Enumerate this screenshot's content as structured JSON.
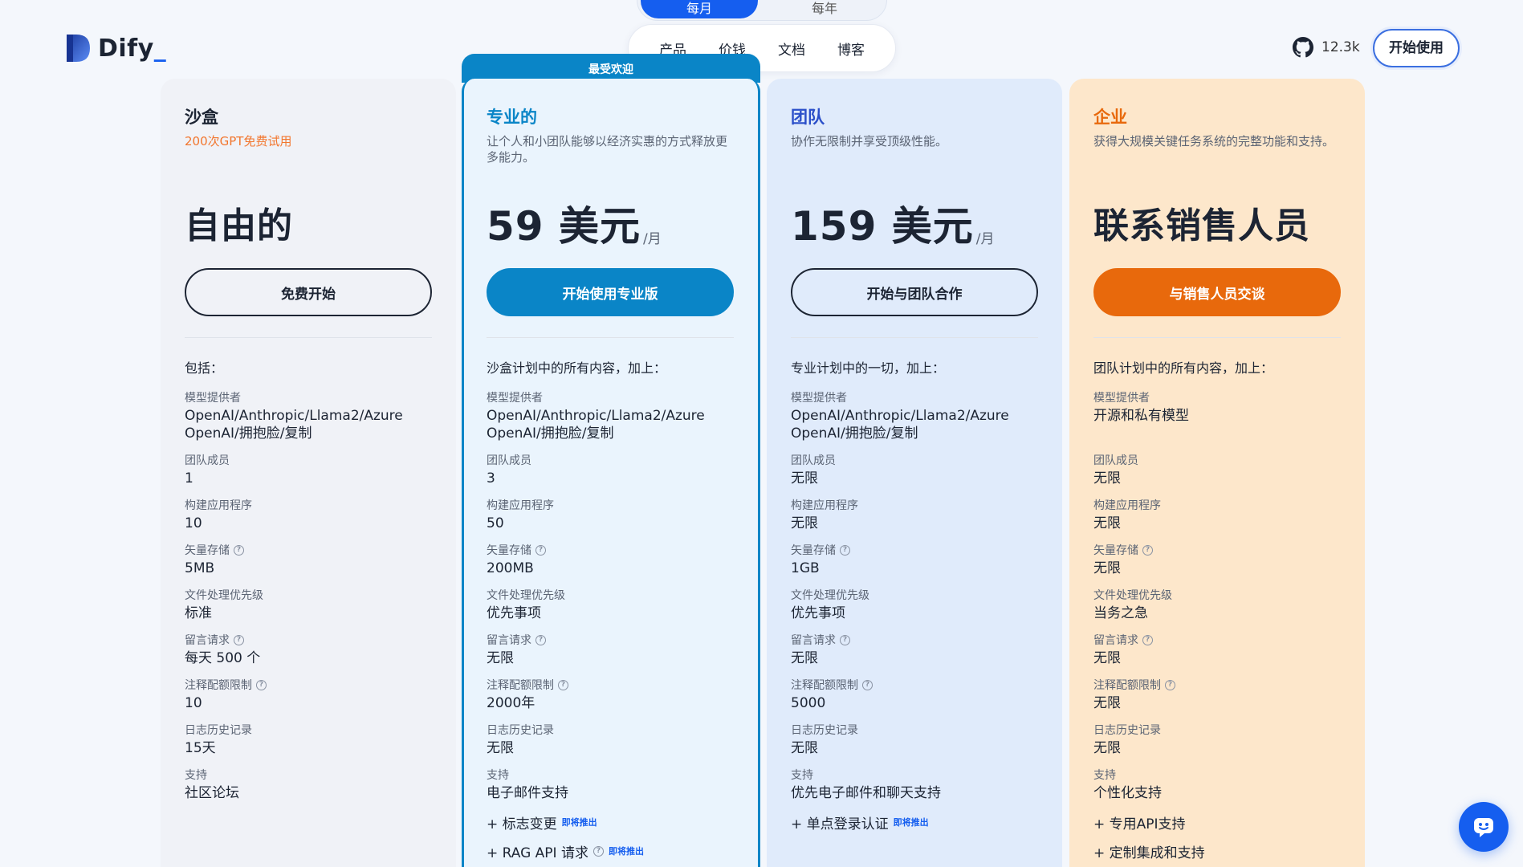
{
  "logo": {
    "name": "Dify",
    "suffix": "_"
  },
  "period_toggle": {
    "active": "每月",
    "inactive": "每年"
  },
  "nav": {
    "items": [
      "产品",
      "价钱",
      "文档",
      "博客"
    ]
  },
  "github": {
    "stars": "12.3k"
  },
  "header": {
    "start_label": "开始使用"
  },
  "ribbon": "最受欢迎",
  "plans": [
    {
      "name": "沙盒",
      "desc": "200次GPT免费试用",
      "price": "自由的",
      "per": "",
      "cta": "免费开始",
      "includes": "包括：",
      "features": [
        {
          "label": "模型提供者",
          "value": "OpenAI/Anthropic/Llama2/Azure OpenAI/拥抱脸/复制"
        },
        {
          "label": "团队成员",
          "value": "1"
        },
        {
          "label": "构建应用程序",
          "value": "10"
        },
        {
          "label": "矢量存储",
          "value": "5MB"
        },
        {
          "label": "文件处理优先级",
          "value": "标准"
        },
        {
          "label": "留言请求",
          "value": "每天 500 个"
        },
        {
          "label": "注释配额限制",
          "value": "10"
        },
        {
          "label": "日志历史记录",
          "value": "15天"
        },
        {
          "label": "支持",
          "value": "社区论坛"
        }
      ],
      "extras": []
    },
    {
      "name": "专业的",
      "desc": "让个人和小团队能够以经济实惠的方式释放更多能力。",
      "price": "59 美元",
      "per": "/月",
      "cta": "开始使用专业版",
      "includes": "沙盒计划中的所有内容，加上：",
      "features": [
        {
          "label": "模型提供者",
          "value": "OpenAI/Anthropic/Llama2/Azure OpenAI/拥抱脸/复制"
        },
        {
          "label": "团队成员",
          "value": "3"
        },
        {
          "label": "构建应用程序",
          "value": "50"
        },
        {
          "label": "矢量存储",
          "value": "200MB"
        },
        {
          "label": "文件处理优先级",
          "value": "优先事项"
        },
        {
          "label": "留言请求",
          "value": "无限"
        },
        {
          "label": "注释配额限制",
          "value": "2000年"
        },
        {
          "label": "日志历史记录",
          "value": "无限"
        },
        {
          "label": "支持",
          "value": "电子邮件支持"
        }
      ],
      "extras": [
        {
          "text": "+ 标志变更",
          "soon": "即将推出"
        },
        {
          "text": "+ RAG API 请求",
          "soon": "即将推出"
        }
      ]
    },
    {
      "name": "团队",
      "desc": "协作无限制并享受顶级性能。",
      "price": "159 美元",
      "per": "/月",
      "cta": "开始与团队合作",
      "includes": "专业计划中的一切，加上：",
      "features": [
        {
          "label": "模型提供者",
          "value": "OpenAI/Anthropic/Llama2/Azure OpenAI/拥抱脸/复制"
        },
        {
          "label": "团队成员",
          "value": "无限"
        },
        {
          "label": "构建应用程序",
          "value": "无限"
        },
        {
          "label": "矢量存储",
          "value": "1GB"
        },
        {
          "label": "文件处理优先级",
          "value": "优先事项"
        },
        {
          "label": "留言请求",
          "value": "无限"
        },
        {
          "label": "注释配额限制",
          "value": "5000"
        },
        {
          "label": "日志历史记录",
          "value": "无限"
        },
        {
          "label": "支持",
          "value": "优先电子邮件和聊天支持"
        }
      ],
      "extras": [
        {
          "text": "+ 单点登录认证",
          "soon": "即将推出"
        }
      ]
    },
    {
      "name": "企业",
      "desc": "获得大规模关键任务系统的完整功能和支持。",
      "price": "联系销售人员",
      "per": "",
      "cta": "与销售人员交谈",
      "includes": "团队计划中的所有内容，加上：",
      "features": [
        {
          "label": "模型提供者",
          "value": "开源和私有模型"
        },
        {
          "label": "团队成员",
          "value": "无限"
        },
        {
          "label": "构建应用程序",
          "value": "无限"
        },
        {
          "label": "矢量存储",
          "value": "无限"
        },
        {
          "label": "文件处理优先级",
          "value": "当务之急"
        },
        {
          "label": "留言请求",
          "value": "无限"
        },
        {
          "label": "注释配额限制",
          "value": "无限"
        },
        {
          "label": "日志历史记录",
          "value": "无限"
        },
        {
          "label": "支持",
          "value": "个性化支持"
        }
      ],
      "extras": [
        {
          "text": "+ 专用API支持",
          "soon": ""
        },
        {
          "text": "+ 定制集成和支持",
          "soon": ""
        }
      ]
    }
  ],
  "colors": {
    "pro": "#0a85c7",
    "team": "#2b4fc9",
    "enterprise": "#e8690c",
    "sandbox_accent": "#f2762e"
  }
}
